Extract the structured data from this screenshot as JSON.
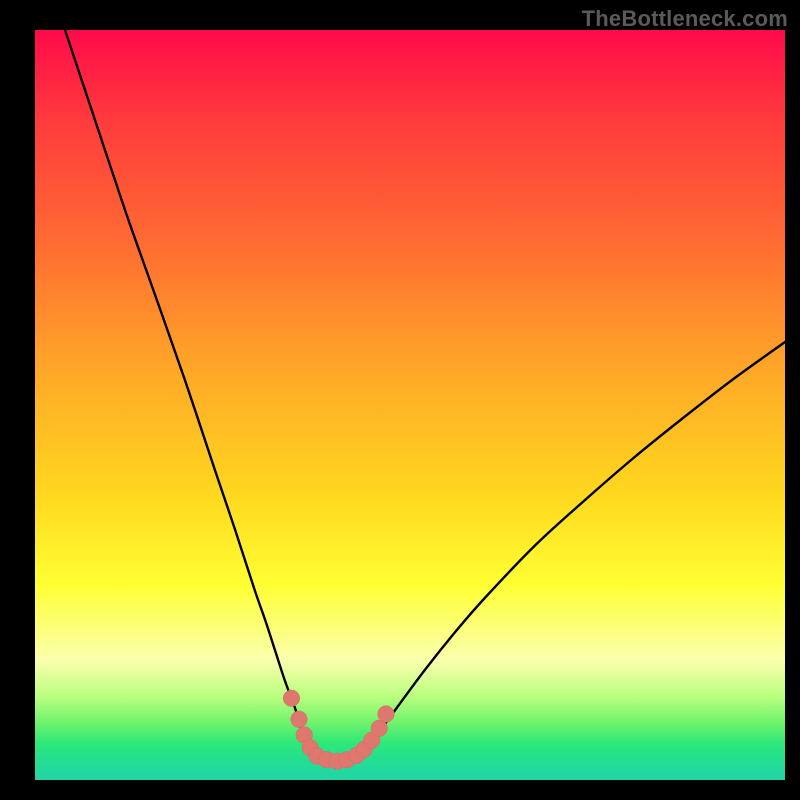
{
  "watermark": {
    "text": "TheBottleneck.com"
  },
  "colors": {
    "curve_stroke": "#000000",
    "marker_fill": "#e0776e",
    "marker_stroke": "#d7695f"
  },
  "chart_data": {
    "type": "line",
    "title": "",
    "xlabel": "",
    "ylabel": "",
    "xlim": [
      0,
      100
    ],
    "ylim": [
      0,
      100
    ],
    "series": [
      {
        "name": "left-branch",
        "x": [
          4.0,
          8.0,
          12.0,
          16.0,
          20.0,
          24.0,
          26.7,
          29.3,
          30.7,
          32.0,
          33.3,
          34.7,
          35.5,
          36.3,
          36.9
        ],
        "y": [
          100.0,
          88.0,
          76.0,
          64.7,
          53.3,
          41.3,
          33.3,
          25.3,
          21.3,
          17.3,
          13.3,
          9.5,
          6.8,
          4.4,
          3.2
        ]
      },
      {
        "name": "valley-floor",
        "x": [
          36.9,
          38.0,
          39.3,
          40.7,
          42.0,
          43.3
        ],
        "y": [
          3.2,
          2.7,
          2.5,
          2.5,
          2.7,
          3.2
        ]
      },
      {
        "name": "right-branch",
        "x": [
          43.3,
          45.3,
          48.0,
          52.0,
          56.0,
          60.0,
          66.7,
          73.3,
          80.0,
          86.7,
          93.3,
          100.0
        ],
        "y": [
          3.2,
          5.6,
          9.3,
          14.7,
          19.7,
          24.3,
          31.3,
          37.3,
          43.1,
          48.5,
          53.6,
          58.4
        ]
      }
    ],
    "markers": {
      "name": "highlight-points",
      "x": [
        34.2,
        35.2,
        35.9,
        36.7,
        37.6,
        38.9,
        40.3,
        41.6,
        42.9,
        43.9,
        44.9,
        45.9,
        46.8
      ],
      "y": [
        10.9,
        8.1,
        6.0,
        4.3,
        3.2,
        2.7,
        2.5,
        2.7,
        3.3,
        4.1,
        5.3,
        6.9,
        8.8
      ],
      "radius": 1.1
    }
  }
}
